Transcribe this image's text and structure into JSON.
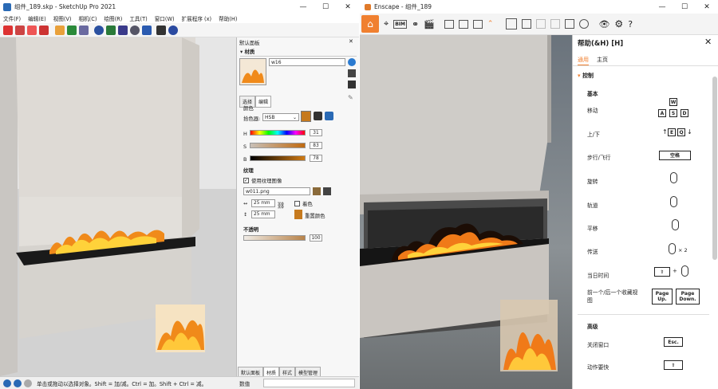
{
  "sketchup": {
    "title": "组件_189.skp - SketchUp Pro 2021",
    "menu": [
      "文件(F)",
      "编辑(E)",
      "视图(V)",
      "相机(C)",
      "绘图(R)",
      "工具(T)",
      "窗口(W)",
      "扩展程序 (x)",
      "帮助(H)"
    ],
    "status_text": "单击或拖动以选择对象。Shift = 加/减。Ctrl = 加。Shift + Ctrl = 减。",
    "status_value_label": "数值",
    "panel": {
      "title": "默认面板",
      "section": "材质",
      "material_name": "w16",
      "tab_select": "选择",
      "tab_edit": "编辑",
      "color_label": "颜色",
      "picker_label": "拾色器:",
      "picker_value": "HSB",
      "h_label": "H",
      "h_value": "31",
      "s_label": "S",
      "s_value": "83",
      "b_label": "B",
      "b_value": "78",
      "texture_label": "纹理",
      "use_texture_label": "使用纹理图像",
      "texture_file": "w011.png",
      "width_value": "25 mm",
      "height_value": "25 mm",
      "colorize_label": "着色",
      "reset_label": "重置颜色",
      "opacity_label": "不透明",
      "opacity_value": "100",
      "bottom_tabs": [
        "默认面板",
        "材质",
        "样式",
        "模型管理"
      ]
    }
  },
  "enscape": {
    "title": "Enscape - 组件_189",
    "help": {
      "title": "帮助(&H) [H]",
      "tab_general": "通用",
      "tab_home": "主页",
      "section_control": "控制",
      "basic": "基本",
      "rows": [
        {
          "label": "移动",
          "keys": "W A S D"
        },
        {
          "label": "上/下",
          "keys": "E Q"
        },
        {
          "label": "步行/飞行",
          "key": "空格"
        },
        {
          "label": "旋转"
        },
        {
          "label": "轨道"
        },
        {
          "label": "平移"
        },
        {
          "label": "传送",
          "extra": "× 2"
        },
        {
          "label": "当日时间"
        },
        {
          "label": "前一个/后一个收藏视图",
          "page_up": "Page Up.",
          "page_down": "Page Down."
        }
      ],
      "advanced": "高级",
      "adv_rows": [
        {
          "label": "关闭窗口",
          "key": "Esc."
        },
        {
          "label": "动作要快"
        }
      ]
    }
  }
}
